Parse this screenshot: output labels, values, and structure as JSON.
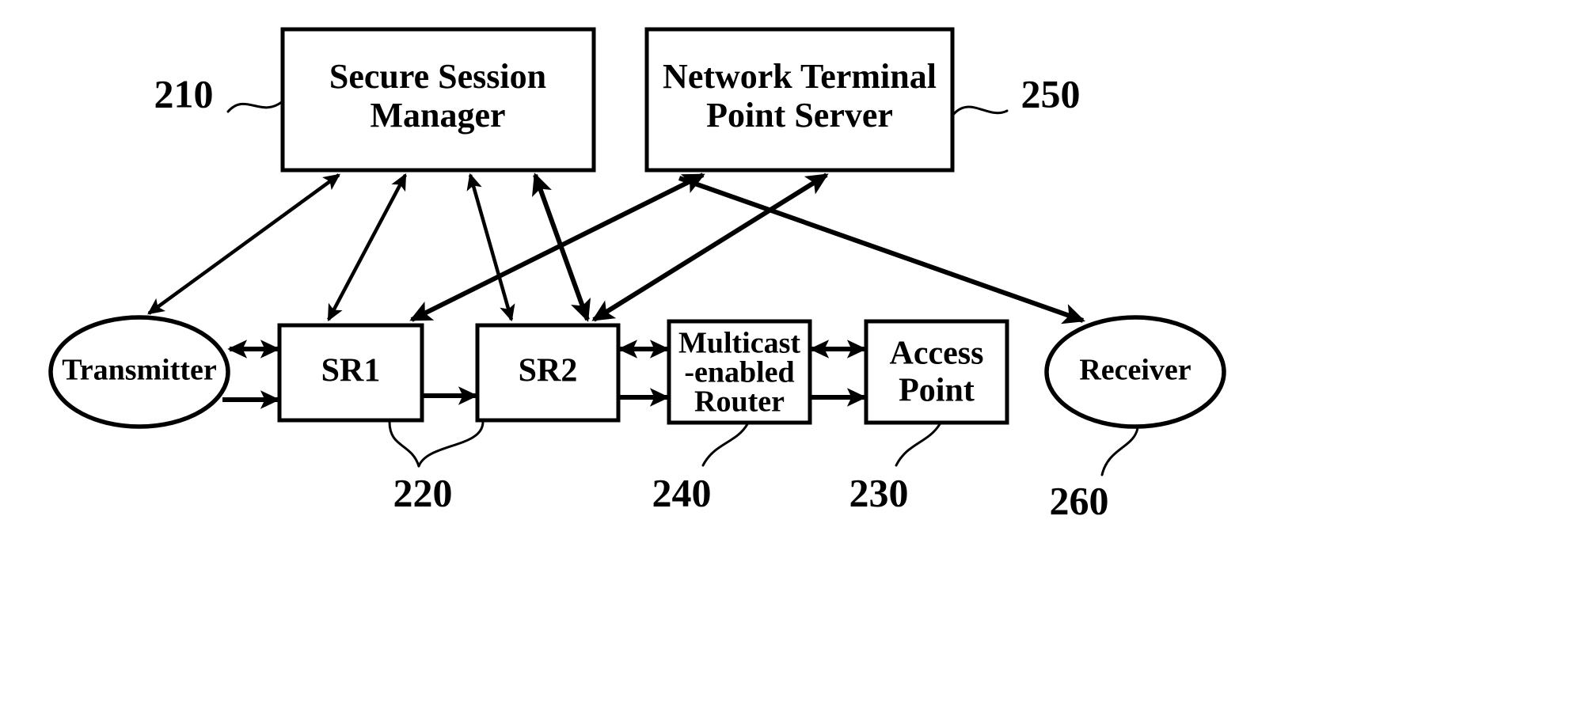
{
  "figure": {
    "title": "Network architecture block diagram",
    "background_color": "#ffffff",
    "stroke_color": "#000000"
  },
  "nodes": {
    "secure_session_manager": {
      "id": "210",
      "shape": "rectangle",
      "line1": "Secure Session",
      "line2": "Manager"
    },
    "network_terminal_point_server": {
      "id": "250",
      "shape": "rectangle",
      "line1": "Network Terminal",
      "line2": "Point Server"
    },
    "transmitter": {
      "id": "",
      "shape": "ellipse",
      "line1": "Transmitter"
    },
    "sr1": {
      "id": "220",
      "shape": "rectangle",
      "line1": "SR1"
    },
    "sr2": {
      "id": "220",
      "shape": "rectangle",
      "line1": "SR2"
    },
    "multicast_router": {
      "id": "240",
      "shape": "rectangle",
      "line1": "Multicast",
      "line2": "-enabled",
      "line3": "Router"
    },
    "access_point": {
      "id": "230",
      "shape": "rectangle",
      "line1": "Access",
      "line2": "Point"
    },
    "receiver": {
      "id": "260",
      "shape": "ellipse",
      "line1": "Receiver"
    }
  },
  "reference_numerals": {
    "ssm": "210",
    "secure_routers": "220",
    "access_point": "230",
    "multicast_router": "240",
    "ntps": "250",
    "receiver": "260"
  },
  "connections": [
    {
      "from": "secure_session_manager",
      "to": "transmitter",
      "arrows": "both"
    },
    {
      "from": "secure_session_manager",
      "to": "sr1",
      "arrows": "both"
    },
    {
      "from": "secure_session_manager",
      "to": "sr2",
      "arrows": "both"
    },
    {
      "from": "network_terminal_point_server",
      "to": "sr1",
      "arrows": "both"
    },
    {
      "from": "network_terminal_point_server",
      "to": "sr2",
      "arrows": "both"
    },
    {
      "from": "network_terminal_point_server",
      "to": "receiver",
      "arrows": "forward"
    },
    {
      "from": "transmitter",
      "to": "sr1",
      "arrows": "both"
    },
    {
      "from": "transmitter",
      "to": "sr1",
      "arrows": "forward"
    },
    {
      "from": "sr1",
      "to": "sr2",
      "arrows": "forward"
    },
    {
      "from": "sr2",
      "to": "multicast_router",
      "arrows": "both"
    },
    {
      "from": "sr2",
      "to": "multicast_router",
      "arrows": "forward"
    },
    {
      "from": "multicast_router",
      "to": "access_point",
      "arrows": "both"
    },
    {
      "from": "multicast_router",
      "to": "access_point",
      "arrows": "forward"
    }
  ]
}
